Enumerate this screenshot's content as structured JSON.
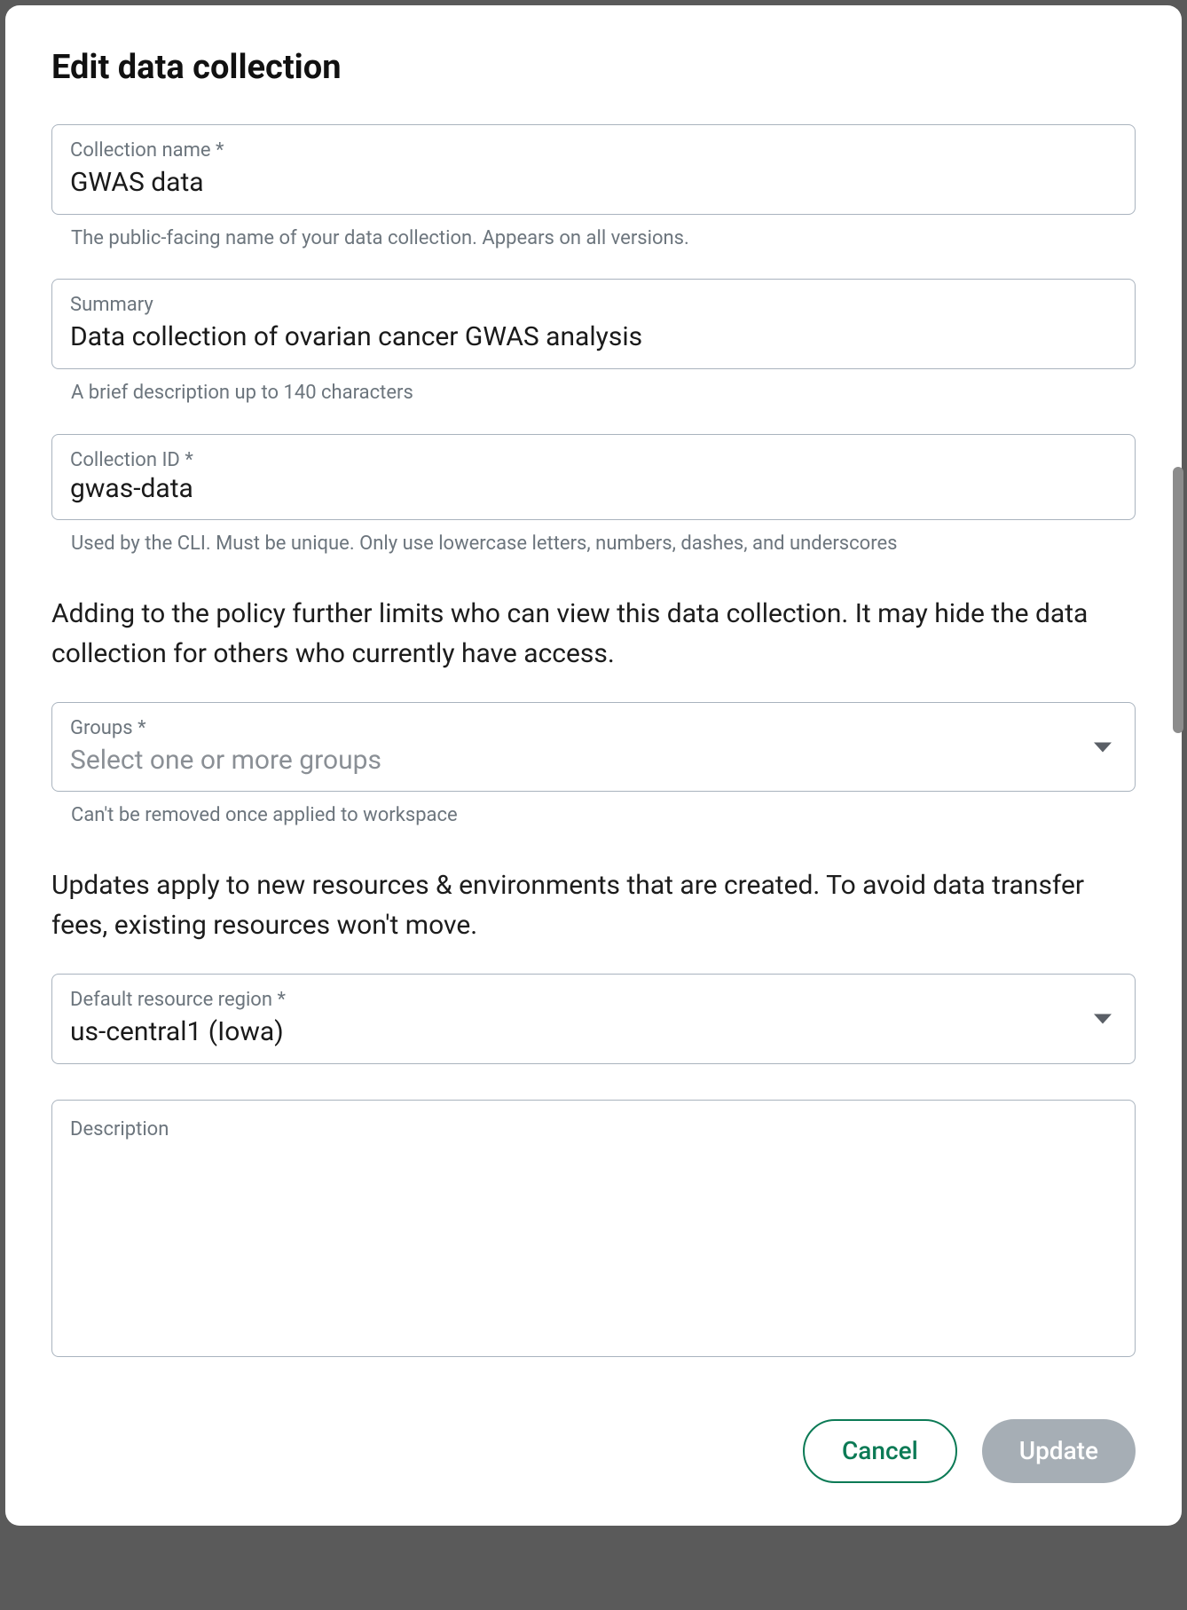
{
  "title": "Edit data collection",
  "fields": {
    "name": {
      "label": "Collection name *",
      "value": "GWAS data",
      "helper": "The public-facing name of your data collection. Appears on all versions."
    },
    "summary": {
      "label": "Summary",
      "value": "Data collection of ovarian cancer GWAS analysis",
      "helper": "A brief description up to 140 characters"
    },
    "collection_id": {
      "label": "Collection ID *",
      "value": "gwas-data",
      "helper": "Used by the CLI. Must be unique. Only use lowercase letters, numbers, dashes, and underscores"
    },
    "policy_note": "Adding to the policy further limits who can view this data collection. It may hide the data collection for others who currently have access.",
    "groups": {
      "label": "Groups *",
      "placeholder": "Select one or more groups",
      "helper": "Can't be removed once applied to workspace"
    },
    "updates_note": "Updates apply to new resources & environments that are created. To avoid data transfer fees, existing resources won't move.",
    "region": {
      "label": "Default resource region *",
      "value": "us-central1 (Iowa)"
    },
    "description": {
      "label": "Description"
    }
  },
  "buttons": {
    "cancel": "Cancel",
    "update": "Update"
  }
}
